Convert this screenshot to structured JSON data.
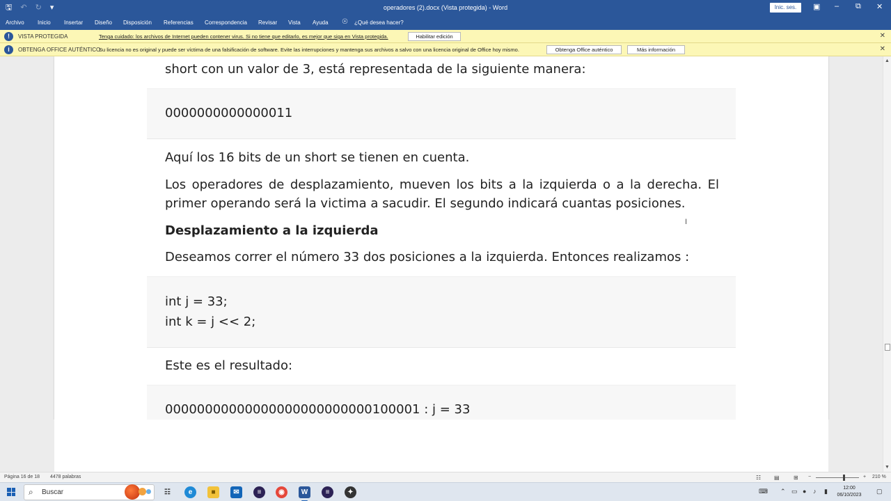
{
  "window": {
    "title": "operadores (2).docx (Vista protegida) - Word",
    "signin_label": "Inic. ses.",
    "qat": {
      "save_icon": "save-icon",
      "undo_icon": "undo-icon",
      "redo_icon": "redo-icon",
      "customize_icon": "customize-icon"
    }
  },
  "ribbon": {
    "tabs": [
      "Archivo",
      "Inicio",
      "Insertar",
      "Diseño",
      "Disposición",
      "Referencias",
      "Correspondencia",
      "Revisar",
      "Vista",
      "Ayuda"
    ],
    "tell_me": "¿Qué desea hacer?"
  },
  "protected_view_bar": {
    "heading": "VISTA PROTEGIDA",
    "message": "Tenga cuidado: los archivos de Internet pueden contener virus. Si no tiene que editarlo, es mejor que siga en Vista protegida.",
    "button": "Habilitar edición"
  },
  "office_bar": {
    "heading": "OBTENGA OFFICE AUTÉNTICO",
    "message": "Su licencia no es original y puede ser víctima de una falsificación de software. Evite las interrupciones y mantenga sus archivos a salvo con una licencia original de Office hoy mismo.",
    "button_primary": "Obtenga Office auténtico",
    "button_secondary": "Más información"
  },
  "document": {
    "p_top": "short con un valor de 3, está representada de la siguiente manera:",
    "code1": "0000000000000011",
    "p1": "Aquí los 16 bits de un short se tienen en cuenta.",
    "p2_line1": "Los operadores de desplazamiento, mueven los bits a la izquierda o a la derecha. El",
    "p2_line2": "primer operando será la victima a sacudir. El segundo indicará cuantas posiciones.",
    "heading": "Desplazamiento a la izquierda",
    "p3": "Deseamos correr el número 33 dos posiciones a la izquierda. Entonces realizamos :",
    "code2_line1": "int j = 33;",
    "code2_line2": "int k = j << 2;",
    "p4": "Este es el resultado:",
    "code3": "00000000000000000000000000100001 : j = 33"
  },
  "statusbar": {
    "page": "Página 16 de 18",
    "words": "4478 palabras",
    "zoom": "210 %"
  },
  "taskbar": {
    "search_placeholder": "Buscar",
    "time": "12:00",
    "date": "06/10/2023",
    "apps": [
      "edge-icon",
      "file-explorer-icon",
      "mail-icon",
      "eclipse-icon",
      "chrome-icon",
      "word-icon",
      "eclipse-icon",
      "app-icon"
    ]
  },
  "colors": {
    "ribbon": "#2b579a",
    "message_bar": "#fcf7b6",
    "code_bg": "#f7f7f7"
  }
}
